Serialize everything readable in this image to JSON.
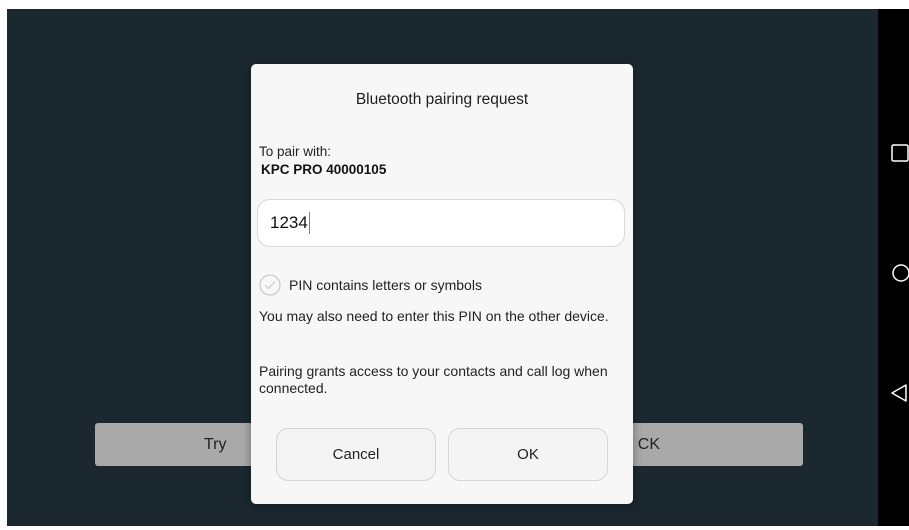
{
  "background": {
    "button_left_text": "Try",
    "button_right_text": "CK"
  },
  "dialog": {
    "title": "Bluetooth pairing request",
    "pair_label": "To pair with:",
    "device_name": "KPC PRO 40000105",
    "pin_value": "1234",
    "pin_checkbox_label": "PIN contains letters or symbols",
    "pin_checkbox_checked": false,
    "info_pin": "You may also need to enter this PIN on the other device.",
    "info_access": "Pairing grants access to your contacts and call log when connected.",
    "cancel_label": "Cancel",
    "ok_label": "OK"
  },
  "nav_bar": {
    "icons": [
      "recent-apps-icon",
      "home-icon",
      "back-icon"
    ]
  },
  "colors": {
    "app_background": "#1b2830",
    "dialog_background": "#f7f7f7",
    "cursor": "#1da6a4",
    "background_button": "#a9a9a9"
  }
}
